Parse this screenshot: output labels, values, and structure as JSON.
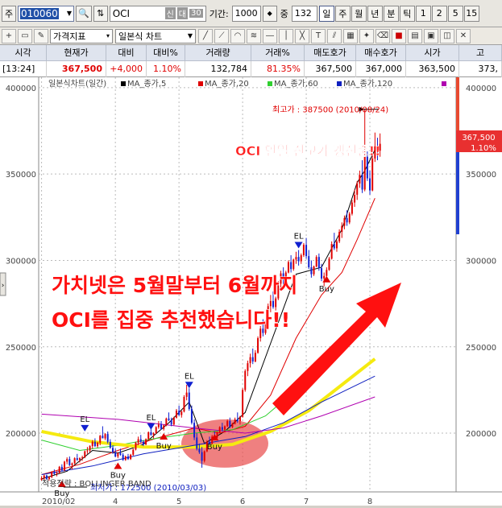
{
  "toolbar": {
    "prefix_label": "주",
    "code": "010060",
    "name": "OCI",
    "tag_credit": "신",
    "tag_margin": "대",
    "tag_rate": "30",
    "period_label": "기간:",
    "period_value": "1000",
    "zoom_label": "중",
    "zoom_value": "132",
    "period_buttons": [
      "일",
      "주",
      "월",
      "년",
      "분",
      "틱",
      "1",
      "2",
      "5",
      "15"
    ],
    "indicator_select": "가격지표",
    "chart_type_select": "일본식 차트"
  },
  "quote": {
    "headers": [
      "시각",
      "현재가",
      "대비",
      "대비%",
      "거래량",
      "거래%",
      "매도호가",
      "매수호가",
      "시가",
      "고"
    ],
    "values": [
      "[13:24]",
      "367,500",
      "+4,000",
      "1.10%",
      "132,784",
      "81.35%",
      "367,500",
      "367,000",
      "363,500",
      "373,"
    ]
  },
  "colors": {
    "up": "#e00000",
    "down": "#1020d0",
    "ma5": "#000000",
    "ma20": "#e00000",
    "ma60": "#30d030",
    "ma120": "#1020c0",
    "ma_yellow": "#f5ea10",
    "ma_purple": "#b000b0",
    "annotation": "#ff0000",
    "highlight": "#e84a4a"
  },
  "chart_data": {
    "type": "candlestick",
    "title": "일본식차트(일간)",
    "legend": [
      "MA_종가,5",
      "MA_종가,20",
      "MA_종가,60",
      "MA_종가,120"
    ],
    "ylim": [
      166000,
      406000
    ],
    "y_ticks": [
      200000,
      250000,
      300000,
      350000,
      400000
    ],
    "x_labels": [
      "2010/02",
      "4",
      "5",
      "6",
      "7",
      "8"
    ],
    "x_label_positions": [
      0,
      29,
      54,
      79,
      104,
      129
    ],
    "n_days": 164,
    "candles": [
      [
        173000,
        175000,
        172500,
        174000
      ],
      [
        174000,
        176000,
        173000,
        175500
      ],
      [
        175500,
        176000,
        173000,
        173500
      ],
      [
        173500,
        175000,
        172500,
        174500
      ],
      [
        174500,
        178000,
        174000,
        177500
      ],
      [
        177500,
        179000,
        176000,
        176500
      ],
      [
        176500,
        178000,
        175000,
        177000
      ],
      [
        177000,
        181000,
        176500,
        180500
      ],
      [
        180500,
        182000,
        178000,
        178500
      ],
      [
        178500,
        184000,
        178000,
        183500
      ],
      [
        183500,
        186000,
        182000,
        185000
      ],
      [
        185000,
        186500,
        181000,
        181500
      ],
      [
        181500,
        183000,
        179000,
        182500
      ],
      [
        182500,
        186000,
        182000,
        185500
      ],
      [
        185500,
        188000,
        184000,
        184500
      ],
      [
        184500,
        186000,
        183000,
        185500
      ],
      [
        185500,
        187000,
        184000,
        186000
      ],
      [
        186000,
        190000,
        185500,
        189500
      ],
      [
        189500,
        192000,
        188000,
        190000
      ],
      [
        190000,
        193000,
        189000,
        192500
      ],
      [
        192500,
        196000,
        191000,
        195000
      ],
      [
        195000,
        197000,
        192000,
        192500
      ],
      [
        192500,
        195000,
        191500,
        194500
      ],
      [
        194500,
        199000,
        193000,
        198500
      ],
      [
        198500,
        204000,
        197500,
        197000
      ],
      [
        197000,
        200000,
        196000,
        199500
      ],
      [
        199500,
        201000,
        194000,
        195000
      ],
      [
        195000,
        196500,
        191000,
        191500
      ],
      [
        191500,
        193000,
        188000,
        189000
      ],
      [
        189000,
        191000,
        186000,
        186500
      ],
      [
        186500,
        189000,
        185500,
        188500
      ],
      [
        188500,
        191000,
        187000,
        187500
      ],
      [
        187500,
        188500,
        184000,
        184500
      ],
      [
        184500,
        187000,
        184000,
        186500
      ],
      [
        186500,
        188000,
        184500,
        185000
      ],
      [
        185000,
        188000,
        184500,
        187500
      ],
      [
        187500,
        191000,
        187000,
        190500
      ],
      [
        190500,
        195000,
        190000,
        194500
      ],
      [
        194500,
        198000,
        193000,
        196500
      ],
      [
        196500,
        199000,
        194500,
        195000
      ],
      [
        195000,
        196000,
        192500,
        193500
      ],
      [
        193500,
        197000,
        193000,
        196500
      ],
      [
        196500,
        201000,
        196000,
        200500
      ],
      [
        200500,
        203000,
        198500,
        199000
      ],
      [
        199000,
        200500,
        197000,
        200000
      ],
      [
        200000,
        204000,
        199500,
        203500
      ],
      [
        203500,
        207000,
        202500,
        205000
      ],
      [
        205000,
        207000,
        202000,
        202500
      ],
      [
        202500,
        205000,
        201500,
        204500
      ],
      [
        204500,
        209000,
        204000,
        208500
      ],
      [
        208500,
        212000,
        207000,
        207500
      ],
      [
        207500,
        209000,
        204000,
        205000
      ],
      [
        205000,
        209500,
        204500,
        209000
      ],
      [
        209000,
        214000,
        208500,
        213000
      ],
      [
        213000,
        216000,
        210000,
        210500
      ],
      [
        210500,
        213000,
        209000,
        212500
      ],
      [
        212500,
        222000,
        212000,
        221000
      ],
      [
        221000,
        228000,
        219000,
        223500
      ],
      [
        223500,
        226000,
        213000,
        214000
      ],
      [
        214000,
        216000,
        205000,
        206000
      ],
      [
        206000,
        208000,
        196000,
        197500
      ],
      [
        197500,
        200000,
        190000,
        191000
      ],
      [
        191000,
        194000,
        188000,
        189000
      ],
      [
        189000,
        192000,
        180000,
        184000
      ],
      [
        184000,
        190000,
        183000,
        189500
      ],
      [
        189500,
        196000,
        189000,
        195000
      ],
      [
        195000,
        198000,
        193000,
        194000
      ],
      [
        194000,
        199000,
        193500,
        198000
      ],
      [
        198000,
        201000,
        196500,
        197500
      ],
      [
        197500,
        201000,
        197000,
        200500
      ],
      [
        200500,
        204000,
        200000,
        203500
      ],
      [
        203500,
        206000,
        201000,
        202000
      ],
      [
        202000,
        204500,
        200500,
        204000
      ],
      [
        204000,
        208000,
        203500,
        207000
      ],
      [
        207000,
        209000,
        203000,
        203500
      ],
      [
        203500,
        206000,
        203000,
        205500
      ],
      [
        205500,
        209000,
        205000,
        208000
      ],
      [
        208000,
        212000,
        206000,
        207000
      ],
      [
        207000,
        210000,
        205000,
        209500
      ],
      [
        209500,
        226000,
        209000,
        225000
      ],
      [
        225000,
        237000,
        224000,
        236000
      ],
      [
        236000,
        242000,
        233000,
        240500
      ],
      [
        240500,
        246000,
        238000,
        244000
      ],
      [
        244000,
        249000,
        240000,
        241500
      ],
      [
        241500,
        248000,
        241000,
        246500
      ],
      [
        246500,
        256000,
        246000,
        255000
      ],
      [
        255000,
        262000,
        253000,
        260500
      ],
      [
        260500,
        266000,
        256000,
        258000
      ],
      [
        258000,
        265000,
        257000,
        264000
      ],
      [
        264000,
        275000,
        263000,
        273500
      ],
      [
        273500,
        280000,
        270000,
        276500
      ],
      [
        276500,
        282000,
        272000,
        273000
      ],
      [
        273000,
        279000,
        271000,
        278000
      ],
      [
        278000,
        288000,
        277000,
        286500
      ],
      [
        286500,
        294000,
        284000,
        292500
      ],
      [
        292500,
        296000,
        286000,
        289000
      ],
      [
        289000,
        294000,
        287000,
        293000
      ],
      [
        293000,
        300000,
        292500,
        299000
      ],
      [
        299000,
        303000,
        293000,
        295000
      ],
      [
        295000,
        301000,
        294000,
        300500
      ],
      [
        300500,
        305000,
        298000,
        302000
      ],
      [
        302000,
        306000,
        297000,
        299500
      ],
      [
        299500,
        304000,
        298000,
        303000
      ],
      [
        303000,
        310000,
        302000,
        309000
      ],
      [
        309000,
        313000,
        301000,
        302500
      ],
      [
        302500,
        306000,
        295000,
        296000
      ],
      [
        296000,
        300000,
        290000,
        292000
      ],
      [
        292000,
        297000,
        291000,
        296500
      ],
      [
        296500,
        303000,
        296000,
        302000
      ],
      [
        302000,
        304000,
        294000,
        295500
      ],
      [
        295500,
        298000,
        288000,
        289500
      ],
      [
        289500,
        293000,
        285000,
        291000
      ],
      [
        291000,
        296000,
        290000,
        294500
      ],
      [
        294500,
        302000,
        294000,
        301000
      ],
      [
        301000,
        311000,
        300500,
        309500
      ],
      [
        309500,
        316000,
        306000,
        307000
      ],
      [
        307000,
        312000,
        305000,
        311000
      ],
      [
        311000,
        318000,
        310000,
        316500
      ],
      [
        316500,
        322000,
        313000,
        320000
      ],
      [
        320000,
        326000,
        318000,
        324500
      ],
      [
        324500,
        329000,
        320000,
        322000
      ],
      [
        322000,
        328000,
        321000,
        327000
      ],
      [
        327000,
        335000,
        326000,
        333500
      ],
      [
        333500,
        341000,
        331000,
        338000
      ],
      [
        338000,
        346000,
        335000,
        344500
      ],
      [
        344500,
        352000,
        342000,
        349500
      ],
      [
        349500,
        358000,
        339000,
        341000
      ],
      [
        341000,
        387500,
        340000,
        360000
      ],
      [
        360000,
        364000,
        346000,
        347500
      ],
      [
        347500,
        352000,
        338000,
        340500
      ],
      [
        340500,
        362000,
        340000,
        359000
      ],
      [
        359000,
        374000,
        357000,
        366000
      ],
      [
        366000,
        371000,
        358000,
        363500
      ],
      [
        363500,
        373500,
        360000,
        367500
      ]
    ],
    "ma": [
      {
        "name": "MA_종가,5",
        "color": "#000000",
        "values": [
          [
            0,
            173500
          ],
          [
            10,
            178000
          ],
          [
            20,
            190000
          ],
          [
            30,
            188500
          ],
          [
            40,
            193500
          ],
          [
            50,
            206000
          ],
          [
            58,
            218000
          ],
          [
            64,
            194000
          ],
          [
            72,
            201000
          ],
          [
            80,
            212000
          ],
          [
            90,
            252000
          ],
          [
            100,
            292000
          ],
          [
            110,
            296000
          ],
          [
            118,
            318000
          ],
          [
            124,
            345000
          ],
          [
            127,
            352000
          ],
          [
            131,
            364000
          ]
        ]
      },
      {
        "name": "MA_종가,20",
        "color": "#e00000",
        "values": [
          [
            0,
            176000
          ],
          [
            15,
            182000
          ],
          [
            30,
            190000
          ],
          [
            45,
            197000
          ],
          [
            60,
            203000
          ],
          [
            70,
            200000
          ],
          [
            80,
            204000
          ],
          [
            90,
            222000
          ],
          [
            100,
            255000
          ],
          [
            110,
            280000
          ],
          [
            118,
            293000
          ],
          [
            124,
            312000
          ],
          [
            131,
            336000
          ]
        ]
      },
      {
        "name": "MA_종가,60",
        "color": "#30d030",
        "values": [
          [
            0,
            196000
          ],
          [
            15,
            190000
          ],
          [
            30,
            193000
          ],
          [
            45,
            197000
          ],
          [
            60,
            200000
          ],
          [
            75,
            202000
          ],
          [
            88,
            210000
          ],
          [
            100,
            225000
          ],
          [
            110,
            240000
          ],
          [
            120,
            258000
          ],
          [
            131,
            274000
          ]
        ]
      },
      {
        "name": "MA_종가,120",
        "color": "#f5ea10",
        "values": [
          [
            0,
            201000
          ],
          [
            20,
            195000
          ],
          [
            40,
            192000
          ],
          [
            60,
            192000
          ],
          [
            75,
            193500
          ],
          [
            90,
            201000
          ],
          [
            105,
            213000
          ],
          [
            118,
            228000
          ],
          [
            131,
            243000
          ]
        ]
      },
      {
        "name": "MA_blue_long",
        "color": "#1020c0",
        "values": [
          [
            0,
            176000
          ],
          [
            20,
            181000
          ],
          [
            40,
            188000
          ],
          [
            60,
            193000
          ],
          [
            80,
            198000
          ],
          [
            95,
            206000
          ],
          [
            110,
            218000
          ],
          [
            131,
            233000
          ]
        ]
      },
      {
        "name": "MA_purple_long",
        "color": "#b000b0",
        "values": [
          [
            0,
            211000
          ],
          [
            30,
            208000
          ],
          [
            60,
            203000
          ],
          [
            80,
            200000
          ],
          [
            95,
            203000
          ],
          [
            110,
            210000
          ],
          [
            131,
            221000
          ]
        ]
      }
    ],
    "signals": [
      {
        "label": "Buy",
        "index": 8,
        "price": 172500,
        "dir": "up"
      },
      {
        "label": "EL",
        "index": 17,
        "price": 201000,
        "dir": "down"
      },
      {
        "label": "Buy",
        "index": 30,
        "price": 183000,
        "dir": "up"
      },
      {
        "label": "EL",
        "index": 43,
        "price": 202000,
        "dir": "down"
      },
      {
        "label": "Buy",
        "index": 48,
        "price": 200000,
        "dir": "up"
      },
      {
        "label": "EL",
        "index": 58,
        "price": 226000,
        "dir": "down"
      },
      {
        "label": "Buy",
        "index": 68,
        "price": 199500,
        "dir": "up"
      },
      {
        "label": "EL",
        "index": 101,
        "price": 307000,
        "dir": "down"
      },
      {
        "label": "Buy",
        "index": 112,
        "price": 291000,
        "dir": "up"
      }
    ],
    "annotations": {
      "high_label": "최고가 : 387500 (2010/08/24)",
      "low_label": "최저가 : 172500 (2010/03/03)",
      "price_tag": "367,500",
      "pct_tag": "1.10%",
      "headline": "OCI 연일 신고가 갱신중!!",
      "note_line1": "가치넷은 5월말부터 6월까지",
      "note_line2": "OCI를 집중 추천했습니다!!",
      "strategy": "적용전략 : BOLLINGER BAND"
    }
  }
}
